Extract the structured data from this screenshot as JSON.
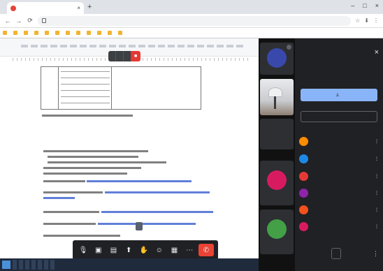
{
  "browser": {
    "tab_title": "",
    "tab_close": "×",
    "new_tab": "+",
    "window_controls": [
      "–",
      "□",
      "×"
    ],
    "nav": [
      "←",
      "→",
      "⟳"
    ],
    "url": "",
    "address_icons": [
      "☆",
      "⬇",
      "⋮"
    ]
  },
  "bookmarks": [
    "",
    "",
    "",
    "",
    "",
    "",
    "",
    "",
    "",
    "",
    "",
    ""
  ],
  "presentation": {
    "name": "",
    "time": "",
    "count": "",
    "view_share_label": ""
  },
  "controls": [
    {
      "name": "mic-icon",
      "glyph": "🎙"
    },
    {
      "name": "camera-icon",
      "glyph": "▣"
    },
    {
      "name": "captions-icon",
      "glyph": "▤"
    },
    {
      "name": "present-icon",
      "glyph": "⬆"
    },
    {
      "name": "hand-icon",
      "glyph": "✋"
    },
    {
      "name": "emoji-icon",
      "glyph": "☺"
    },
    {
      "name": "apps-icon",
      "glyph": "▦"
    },
    {
      "name": "more-icon",
      "glyph": "⋯"
    },
    {
      "name": "hangup-icon",
      "glyph": "✆"
    }
  ],
  "tiles": [
    {
      "avatar": "",
      "color": "#3949ab",
      "label": ""
    },
    {
      "avatar": "",
      "color": "",
      "label": "",
      "photo": true
    },
    {
      "avatar": "",
      "color": "#00897b",
      "label": ""
    },
    {
      "avatar": "",
      "color": "#d81b60",
      "label": ""
    },
    {
      "avatar": "",
      "color": "#43a047",
      "label": ""
    }
  ],
  "panel": {
    "title": "",
    "close": "×",
    "add_label": "",
    "link_label": "",
    "mute_all_label": "",
    "more": "⋮",
    "participants": [
      {
        "avatar": "",
        "color": "#fb8c00",
        "name": "",
        "icons": "⋮"
      },
      {
        "avatar": "",
        "color": "#1e88e5",
        "name": "",
        "icons": "⋮"
      },
      {
        "avatar": "",
        "color": "#e53935",
        "name": "",
        "icons": "⋮"
      },
      {
        "avatar": "",
        "color": "#8e24aa",
        "name": "",
        "icons": "⋮"
      },
      {
        "avatar": "",
        "color": "#f4511e",
        "name": "",
        "icons": "⋮"
      },
      {
        "avatar": "",
        "color": "#d81b60",
        "name": "",
        "icons": "⋮"
      }
    ]
  },
  "taskbar": [
    "",
    "",
    "",
    "",
    "",
    "",
    ""
  ],
  "colors": {
    "accent": "#8ab4f8",
    "stop": "#e53935",
    "hangup": "#ea4335"
  }
}
